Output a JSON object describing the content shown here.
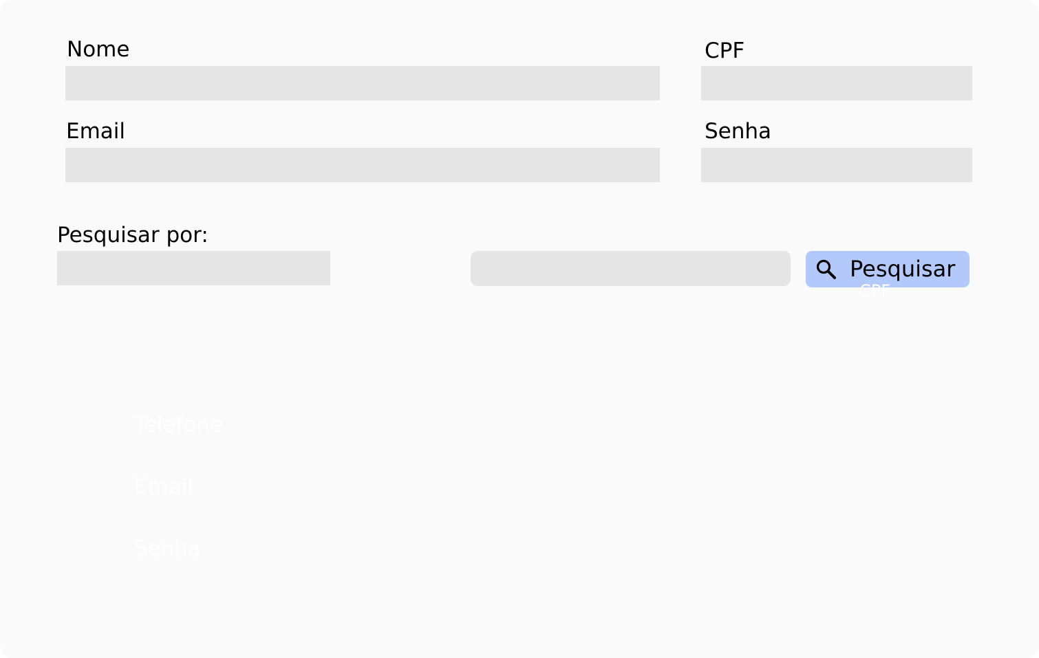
{
  "form": {
    "nome_label": "Nome",
    "cpf_label": "CPF",
    "email_label": "Email",
    "senha_label": "Senha",
    "nome_value": "",
    "cpf_value": "",
    "email_value": "",
    "senha_value": ""
  },
  "search": {
    "label": "Pesquisar por:",
    "filter_value": "",
    "query_value": "",
    "button_label": "Pesquisar",
    "button_icon": "search-icon",
    "button_color": "#b4c9fb"
  },
  "hidden_fields": {
    "items": [
      {
        "label": "Telefone"
      },
      {
        "label": "Email"
      },
      {
        "label": "Senha"
      }
    ],
    "fragment": "CPF"
  },
  "colors": {
    "background": "#fafafa",
    "field": "#e5e5e5",
    "text": "#000000"
  }
}
